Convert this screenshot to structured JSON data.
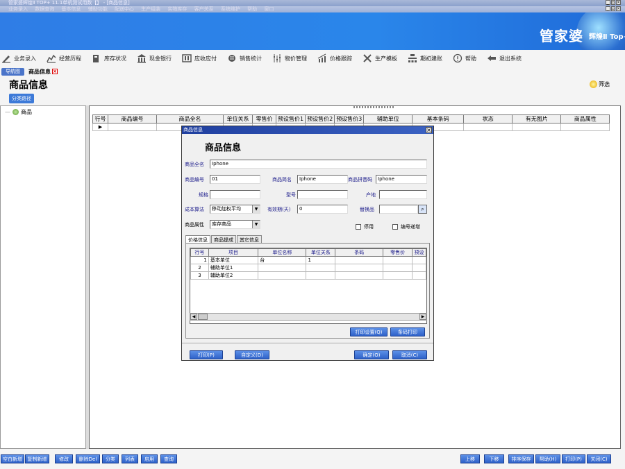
{
  "window": {
    "title": "管家婆辉煌Ⅱ TOP+ 11.1单机测试用数【】 - [商品信息]"
  },
  "menu": [
    "业务录入",
    "数据查询",
    "基本信息",
    "辅助功能",
    "配送中心",
    "生产组装",
    "实物库存",
    "客户关系",
    "系统维护",
    "帮助",
    "窗口"
  ],
  "banner": {
    "brand": "管家婆",
    "subtitle": "辉煌Ⅱ Top+"
  },
  "toolbar": [
    {
      "label": "业务录入",
      "icon": "pen-icon"
    },
    {
      "label": "经营历程",
      "icon": "chart-icon"
    },
    {
      "label": "库存状况",
      "icon": "box-icon"
    },
    {
      "label": "现金银行",
      "icon": "bank-icon"
    },
    {
      "label": "应收应付",
      "icon": "ledger-icon"
    },
    {
      "label": "销售统计",
      "icon": "sales-icon"
    },
    {
      "label": "物价管理",
      "icon": "price-icon"
    },
    {
      "label": "价格跟踪",
      "icon": "trend-icon"
    },
    {
      "label": "生产模板",
      "icon": "tools-icon"
    },
    {
      "label": "期初建账",
      "icon": "init-icon"
    },
    {
      "label": "帮助",
      "icon": "help-icon"
    },
    {
      "label": "退出系统",
      "icon": "exit-icon"
    }
  ],
  "tabs": {
    "nav": "导航图",
    "active": "商品信息"
  },
  "page": {
    "title": "商品信息",
    "path_button": "分类路径",
    "filter": "筛选"
  },
  "tree": {
    "root": "商品"
  },
  "grid": {
    "columns": [
      "行号",
      "商品编号",
      "商品全名",
      "单位关系",
      "零售价",
      "预设售价1",
      "预设售价2",
      "预设售价3",
      "辅助单位",
      "基本条码",
      "状态",
      "有无图片",
      "商品属性"
    ]
  },
  "dialog": {
    "title": "商品信息",
    "heading": "商品信息",
    "fields": {
      "full_name_label": "商品全名",
      "full_name": "Iphone",
      "code_label": "商品编号",
      "code": "01",
      "short_name_label": "商品简名",
      "short_name": "Iphone",
      "pinyin_label": "商品拼音码",
      "pinyin": "Iphone",
      "spec_label": "规格",
      "spec": "",
      "model_label": "型号",
      "model": "",
      "origin_label": "产地",
      "origin": "",
      "cost_label": "成本算法",
      "cost": "移动加权平均",
      "valid_label": "有效期(天)",
      "valid": "0",
      "substitute_label": "替换品",
      "substitute": "",
      "attr_label": "商品属性",
      "attr": "库存商品",
      "disabled_label": "停用",
      "autonum_label": "编号递增"
    },
    "subtabs": [
      "价格信息",
      "商品提成",
      "其它信息"
    ],
    "subgrid": {
      "columns": [
        "行号",
        "项目",
        "单位名称",
        "单位关系",
        "条码",
        "零售价",
        "预设"
      ],
      "rows": [
        [
          "1",
          "基本单位",
          "台",
          "1",
          "",
          "",
          ""
        ],
        [
          "2",
          "辅助单位1",
          "",
          "",
          "",
          "",
          ""
        ],
        [
          "3",
          "辅助单位2",
          "",
          "",
          "",
          "",
          ""
        ]
      ]
    },
    "buttons": {
      "print_settings": "打印设置(Q)",
      "barcode_print": "条码打印",
      "print": "打印(P)",
      "custom": "自定义(D)",
      "ok": "确定(O)",
      "cancel": "取消(C)"
    }
  },
  "bottom": {
    "left": [
      "空白新增",
      "复制新增",
      "修改",
      "删除Del",
      "分类",
      "列表",
      "启用",
      "查询"
    ],
    "right": [
      "上移",
      "下移",
      "排序保存",
      "帮助(H)",
      "打印(P)",
      "关闭(C)"
    ]
  }
}
